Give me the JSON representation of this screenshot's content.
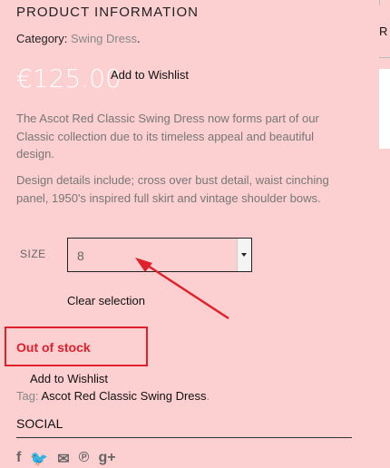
{
  "product": {
    "section_title": "PRODUCT INFORMATION",
    "category_label": "Category:",
    "category_value": "Swing Dress",
    "category_suffix": ".",
    "price": "€125.00",
    "wishlist_label": "Add to Wishlist",
    "description_1": "The Ascot Red Classic Swing Dress now forms part of our Classic collection due to its timeless appeal and beautiful design.",
    "description_2": "Design details include; cross over bust detail, waist cinching panel, 1950's inspired full skirt and vintage shoulder bows."
  },
  "variation": {
    "size_label": "SIZE",
    "size_value": "8",
    "clear_label": "Clear selection"
  },
  "stock": {
    "status": "Out of stock"
  },
  "meta": {
    "wishlist_label": "Add to Wishlist",
    "tag_label": "Tag:",
    "tag_value": "Ascot Red Classic Swing Dress",
    "tag_suffix": "."
  },
  "social": {
    "title": "SOCIAL",
    "icons": [
      "facebook-icon",
      "twitter-icon",
      "email-icon",
      "pinterest-icon",
      "google-plus-icon"
    ],
    "glyphs": [
      "f",
      "🐦",
      "✉",
      "℗",
      "g+"
    ]
  },
  "sidebar": {
    "partial_char": "R"
  },
  "colors": {
    "background": "#fccfd0",
    "annotation_red": "#e0202a"
  }
}
